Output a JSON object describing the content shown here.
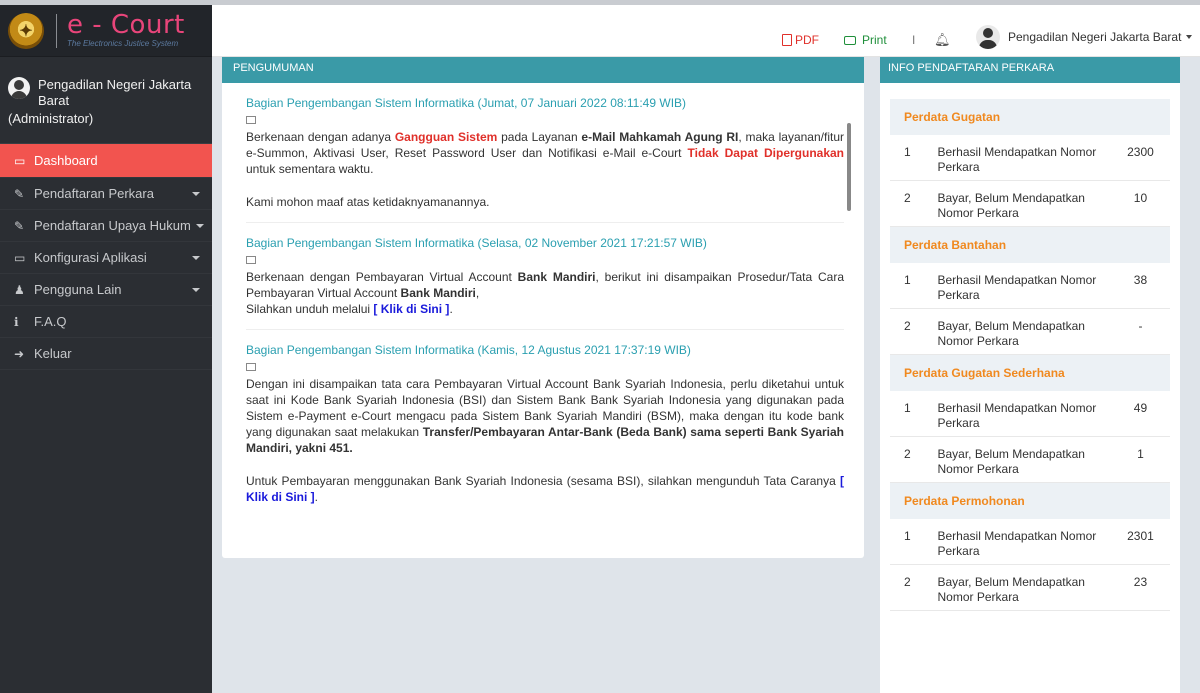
{
  "logo": {
    "emblem_icon": "mahkamah-agung-emblem",
    "title": "e - Court",
    "subtitle": "The Electronics Justice System"
  },
  "user": {
    "name": "Pengadilan Negeri Jakarta Barat",
    "role": "(Administrator)"
  },
  "sidebar": {
    "items": [
      {
        "label": "Dashboard",
        "icon": "monitor-icon",
        "glyph": "▭",
        "active": true,
        "has_caret": false
      },
      {
        "label": "Pendaftaran Perkara",
        "icon": "edit-icon",
        "glyph": "✎",
        "active": false,
        "has_caret": true
      },
      {
        "label": "Pendaftaran Upaya Hukum",
        "icon": "edit-icon",
        "glyph": "✎",
        "active": false,
        "has_caret": true
      },
      {
        "label": "Konfigurasi Aplikasi",
        "icon": "monitor-icon",
        "glyph": "▭",
        "active": false,
        "has_caret": true
      },
      {
        "label": "Pengguna Lain",
        "icon": "users-icon",
        "glyph": "♟",
        "active": false,
        "has_caret": true
      },
      {
        "label": "F.A.Q",
        "icon": "info-icon",
        "glyph": "ℹ",
        "active": false,
        "has_caret": false
      },
      {
        "label": "Keluar",
        "icon": "logout-icon",
        "glyph": "➜",
        "active": false,
        "has_caret": false
      }
    ]
  },
  "topbar": {
    "pdf_label": "PDF",
    "print_label": "Print",
    "divider": "I",
    "user_name": "Pengadilan Negeri Jakarta Barat"
  },
  "announcements": {
    "header": "PENGUMUMAN",
    "items": [
      {
        "title": "Bagian Pengembangan Sistem Informatika (Jumat, 07 Januari 2022 08:11:49 WIB)",
        "body_parts": [
          "Berkenaan dengan adanya ",
          "Gangguan Sistem",
          " pada Layanan ",
          "e-Mail Mahkamah Agung RI",
          ", maka layanan/fitur e-Summon, Aktivasi User, Reset Password User dan Notifikasi e-Mail e-Court ",
          "Tidak Dapat Dipergunakan",
          " untuk sementara waktu."
        ],
        "body_2": "Kami mohon maaf atas ketidaknyamanannya."
      },
      {
        "title": "Bagian Pengembangan Sistem Informatika (Selasa, 02 November 2021 17:21:57 WIB)",
        "body_parts": [
          "Berkenaan dengan Pembayaran Virtual Account ",
          "Bank Mandiri",
          ", berikut ini disampaikan Prosedur/Tata Cara Pembayaran Virtual Account ",
          "Bank Mandiri",
          ","
        ],
        "line_2": "Silahkan unduh melalui ",
        "link": "[ Klik di Sini ]",
        "line_2_end": "."
      },
      {
        "title": "Bagian Pengembangan Sistem Informatika (Kamis, 12 Agustus 2021 17:37:19 WIB)",
        "body_parts": [
          "Dengan ini disampaikan tata cara Pembayaran Virtual Account Bank Syariah Indonesia, perlu diketahui untuk saat ini Kode Bank Syariah Indonesia (BSI) dan Sistem Bank Bank Syariah Indonesia yang digunakan pada Sistem e-Payment e-Court mengacu pada Sistem Bank Syariah Mandiri (BSM), maka dengan itu kode bank yang digunakan saat melakukan ",
          "Transfer/Pembayaran Antar-Bank (Beda Bank) sama seperti Bank Syariah Mandiri, yakni 451."
        ],
        "body_2": "Untuk Pembayaran menggunakan Bank Syariah Indonesia (sesama BSI), silahkan mengunduh Tata Caranya ",
        "link": "[ Klik di Sini ]",
        "end": "."
      }
    ]
  },
  "info": {
    "header": "INFO PENDAFTARAN PERKARA",
    "categories": [
      {
        "name": "Perdata Gugatan",
        "rows": [
          {
            "no": "1",
            "label": "Berhasil Mendapatkan Nomor Perkara",
            "value": "2300"
          },
          {
            "no": "2",
            "label": "Bayar, Belum Mendapatkan Nomor Perkara",
            "value": "10"
          }
        ]
      },
      {
        "name": "Perdata Bantahan",
        "rows": [
          {
            "no": "1",
            "label": "Berhasil Mendapatkan Nomor Perkara",
            "value": "38"
          },
          {
            "no": "2",
            "label": "Bayar, Belum Mendapatkan Nomor Perkara",
            "value": "-"
          }
        ]
      },
      {
        "name": "Perdata Gugatan Sederhana",
        "rows": [
          {
            "no": "1",
            "label": "Berhasil Mendapatkan Nomor Perkara",
            "value": "49"
          },
          {
            "no": "2",
            "label": "Bayar, Belum Mendapatkan Nomor Perkara",
            "value": "1"
          }
        ]
      },
      {
        "name": "Perdata Permohonan",
        "rows": [
          {
            "no": "1",
            "label": "Berhasil Mendapatkan Nomor Perkara",
            "value": "2301"
          },
          {
            "no": "2",
            "label": "Bayar, Belum Mendapatkan Nomor Perkara",
            "value": "23"
          }
        ]
      }
    ]
  },
  "colors": {
    "sidebar_bg": "#2b2e33",
    "active_item": "#f2544f",
    "panel_header": "#3a9aa7",
    "category_text": "#f0891f",
    "title_link": "#2a9fb0"
  }
}
